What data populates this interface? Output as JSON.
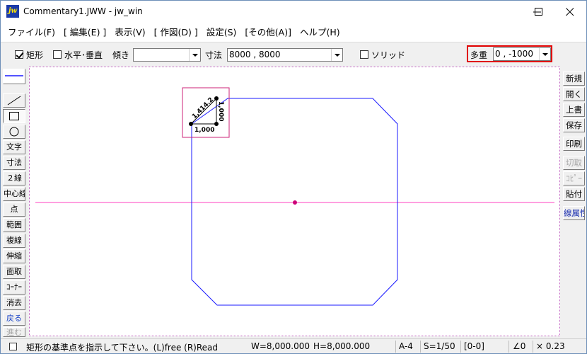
{
  "window": {
    "app_icon": "jw",
    "title": "Commentary1.JWW - jw_win",
    "minimize_icon": "minimize-icon",
    "maximize_icon": "maximize-icon",
    "close_icon": "close-icon"
  },
  "menu": [
    "ファイル(F)",
    "[ 編集(E) ]",
    "表示(V)",
    "[ 作図(D) ]",
    "設定(S)",
    "[その他(A)]",
    "ヘルプ(H)"
  ],
  "toolbar": {
    "rect_label": "矩形",
    "rect_checked": true,
    "hv_label": "水平･垂直",
    "hv_checked": false,
    "tilt_label": "傾き",
    "tilt_value": "",
    "size_label": "寸法",
    "size_value": "8000 , 8000",
    "solid_label": "ソリッド",
    "solid_checked": false,
    "multi_label": "多重",
    "multi_value": "0 , -1000"
  },
  "left_tools": [
    {
      "label": "",
      "icon": "line-style-icon"
    },
    {
      "label": "",
      "icon": "line-icon"
    },
    {
      "label": "",
      "icon": "rectangle-icon",
      "pressed": true
    },
    {
      "label": "",
      "icon": "circle-icon"
    },
    {
      "label": "文字"
    },
    {
      "label": "寸法"
    },
    {
      "label": "２線"
    },
    {
      "label": "中心線"
    },
    {
      "label": "点"
    },
    {
      "label": "範囲"
    },
    {
      "label": "複線"
    },
    {
      "label": "伸縮"
    },
    {
      "label": "面取"
    },
    {
      "label": "ｺｰﾅｰ"
    },
    {
      "label": "消去"
    },
    {
      "label": "戻る",
      "blue": true
    },
    {
      "label": "進む",
      "disabled": true
    }
  ],
  "right_tools": [
    {
      "label": "新規"
    },
    {
      "label": "開く"
    },
    {
      "label": "上書"
    },
    {
      "label": "保存"
    },
    {
      "label": "印刷"
    },
    {
      "label": "切取",
      "disabled": true
    },
    {
      "label": "ｺﾋﾟｰ",
      "disabled": true
    },
    {
      "label": "貼付"
    },
    {
      "label": "線属性",
      "blue": true
    }
  ],
  "drawing": {
    "dim_horizontal": "1,000",
    "dim_vertical": "1,000",
    "dim_diagonal": "1,414.2",
    "colors": {
      "shape_outline": "#1a1aff",
      "axis_line": "#ff40c0",
      "center_point": "#cc0077",
      "highlight_box": "#cc2277",
      "canvas_border": "#c060c0"
    }
  },
  "status": {
    "message": "矩形の基準点を指示して下さい。(L)free (R)Read",
    "width": "W=8,000.000",
    "height": "H=8,000.000",
    "paper": "A-4",
    "scale": "S=1/50",
    "layer": "[0-0]",
    "angle": "∠0",
    "zoom": "× 0.23"
  }
}
